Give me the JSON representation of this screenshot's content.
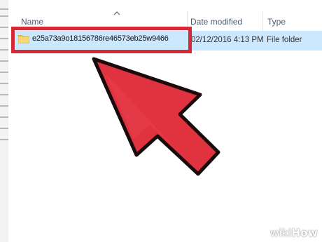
{
  "columns": {
    "name": "Name",
    "date_modified": "Date modified",
    "type": "Type"
  },
  "row": {
    "name": "e25a73a9o18156786re46573eb25w9466",
    "date_modified": "02/12/2016 4:13 PM",
    "type": "File folder"
  },
  "icons": {
    "folder": "folder-icon",
    "sort": "sort-up-chevron-icon",
    "pointer": "big-red-pointer-arrow-icon"
  },
  "colors": {
    "highlight_red": "#d42a35",
    "selection_blue": "#cce8ff",
    "arrow_outline": "#1a0c0c"
  },
  "watermark": {
    "prefix": "wiki",
    "suffix": "How"
  }
}
